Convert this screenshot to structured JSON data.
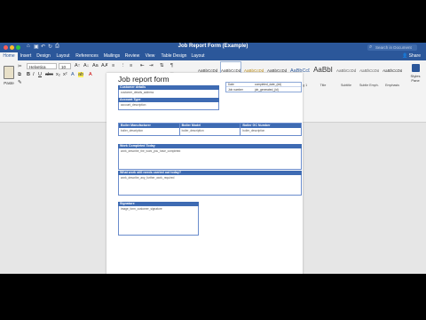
{
  "window": {
    "title": "Job Report Form (Example)",
    "search_placeholder": "Search in Document"
  },
  "tabs": [
    {
      "label": "Home",
      "active": true
    },
    {
      "label": "Insert"
    },
    {
      "label": "Design"
    },
    {
      "label": "Layout"
    },
    {
      "label": "References"
    },
    {
      "label": "Mailings"
    },
    {
      "label": "Review"
    },
    {
      "label": "View"
    },
    {
      "label": "Table Design"
    },
    {
      "label": "Layout"
    }
  ],
  "share_label": "Share",
  "ribbon": {
    "paste_label": "Paste",
    "font_name": "Helvetica",
    "font_size": "10",
    "styles": [
      {
        "sample": "AaBbCcDdEe",
        "name": "Normal",
        "selected": false
      },
      {
        "sample": "AaBbCcDdEe",
        "name": "Table Grid",
        "selected": true
      },
      {
        "sample": "AaBbCcDdEe",
        "name": "Table Applic...",
        "selected": false
      },
      {
        "sample": "AaBbCcDdEe",
        "name": "No Spacing",
        "selected": false
      },
      {
        "sample": "AaBbCcDc",
        "name": "Heading 1",
        "selected": false
      },
      {
        "sample": "AaBbI",
        "name": "Title",
        "selected": false
      },
      {
        "sample": "AaBbCcDdEe",
        "name": "Subtitle",
        "selected": false
      },
      {
        "sample": "AaBbCcDdEe",
        "name": "Subtle Emph...",
        "selected": false
      },
      {
        "sample": "AaBbCcDdEe",
        "name": "Emphasis",
        "selected": false
      }
    ],
    "styles_pane_label": "Styles Pane"
  },
  "document": {
    "heading": "Job report form",
    "customer_details": {
      "header": "Customer details",
      "value": "customer_details_address"
    },
    "account_type": {
      "header": "Account Type",
      "value": "account_description"
    },
    "info_rows": [
      {
        "key": "Date",
        "value": "completed_date_(dd)"
      },
      {
        "key": "Job number",
        "value": "job_generated_(id)"
      }
    ],
    "boiler_columns": [
      {
        "header": "Boiler Manufacturer",
        "value": "boiler_description"
      },
      {
        "header": "Boiler Model",
        "value": "boiler_description"
      },
      {
        "header": "Boiler GC Number",
        "value": "boiler_description"
      }
    ],
    "work_completed": {
      "header": "Work Completed Today",
      "value": "work_describe_the_work_you_have_completed"
    },
    "work_needed": {
      "header": "What work still needs carried out today?",
      "value": "work_describe_any_further_work_required"
    },
    "signature": {
      "header": "Signature",
      "value": "image_form_customer_signature"
    }
  },
  "colors": {
    "accent": "#2b579a",
    "table_header": "#3e6bb3"
  }
}
